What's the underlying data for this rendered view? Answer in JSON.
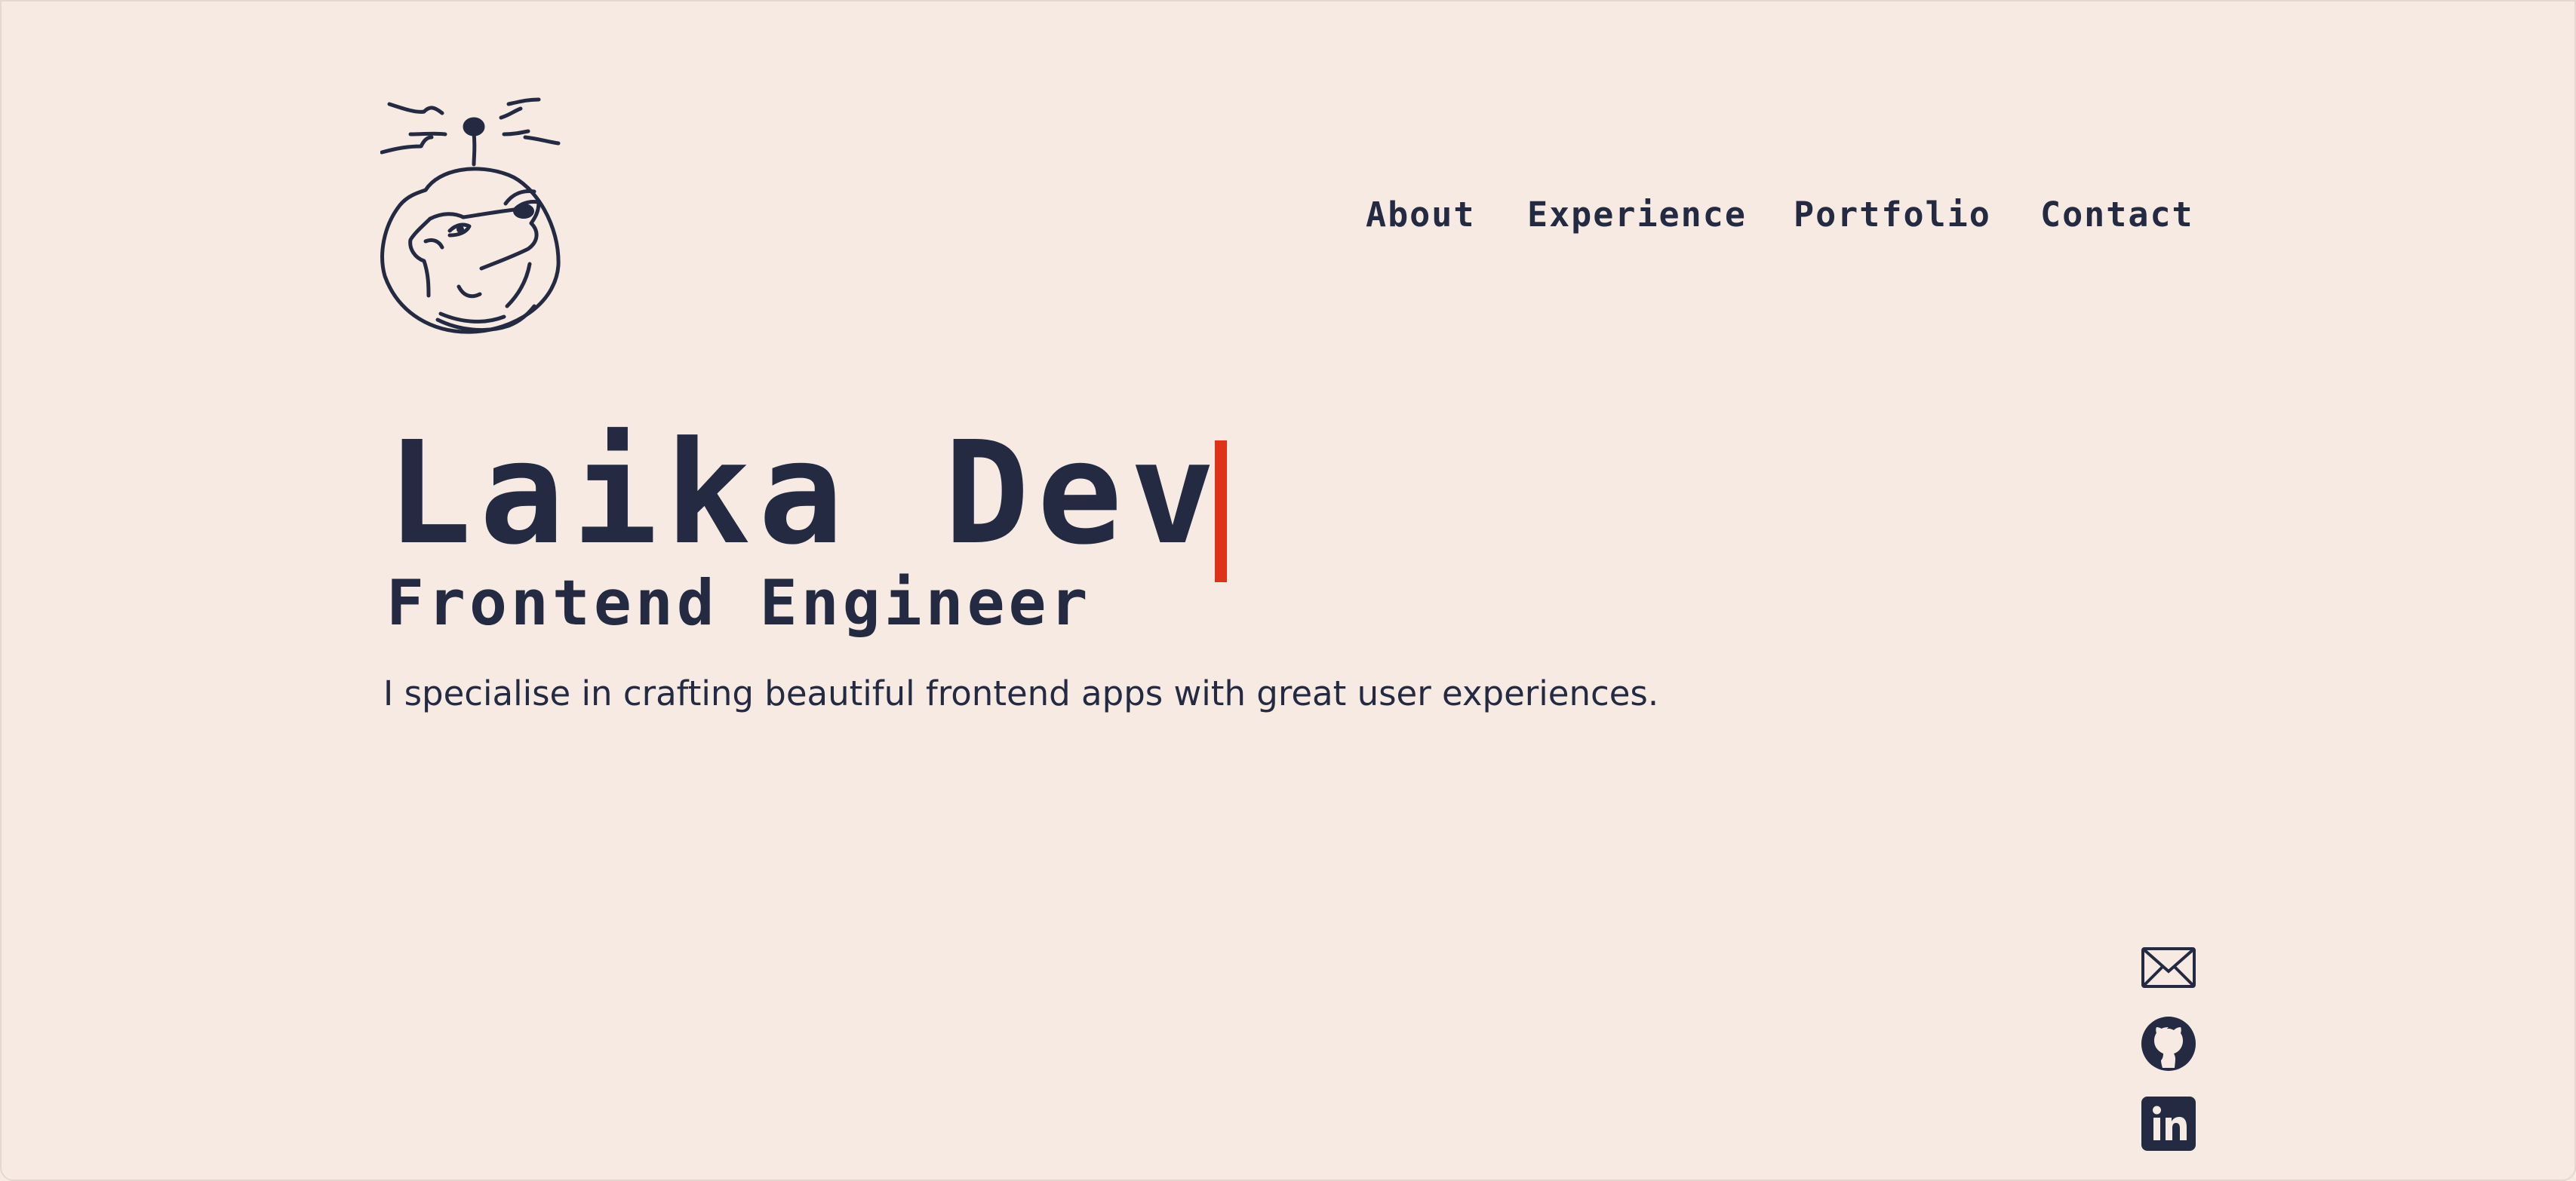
{
  "header": {
    "logo": {
      "icon": "space-dog-logo-icon"
    },
    "nav": {
      "items": [
        {
          "label": "About"
        },
        {
          "label": "Experience"
        },
        {
          "label": "Portfolio"
        },
        {
          "label": "Contact"
        }
      ]
    }
  },
  "hero": {
    "name": "Laika Dev",
    "role": "Frontend Engineer",
    "description": "I specialise in crafting beautiful frontend apps with great user experiences."
  },
  "social": {
    "items": [
      {
        "icon": "mail-icon"
      },
      {
        "icon": "github-icon"
      },
      {
        "icon": "linkedin-icon"
      }
    ]
  },
  "colors": {
    "background": "#f7eae3",
    "text": "#232a42",
    "accent": "#e0321a"
  }
}
